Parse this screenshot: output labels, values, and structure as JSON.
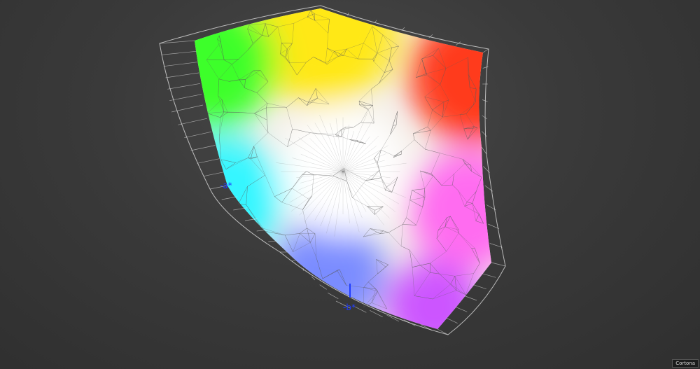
{
  "chart_data": {
    "type": "scatter",
    "title": "",
    "axes": {
      "minus_b_label": "-b*",
      "minus_a_label": "-a*"
    },
    "colors": {
      "background": "#3a3a3a",
      "axis_marker": "#1f3cff",
      "wireframe": "#e6e6e6",
      "corner_top": "#ffe817",
      "corner_green": "#3dff2a",
      "corner_red": "#ff3a1a",
      "corner_cyan": "#34f6ff",
      "corner_blue": "#7a8cff",
      "corner_magenta": "#cc55ff",
      "corner_pink": "#ff6cf0",
      "center_white": "#ffffff"
    }
  },
  "watermark": {
    "text": "Cortona"
  }
}
